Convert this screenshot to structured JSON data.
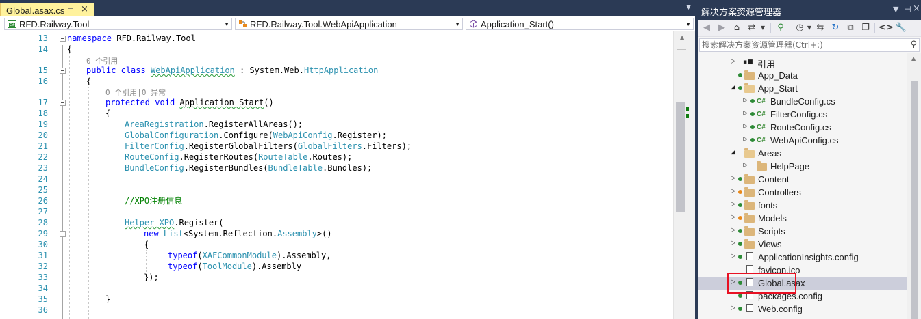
{
  "editor": {
    "tab": {
      "label": "Global.asax.cs"
    },
    "nav": {
      "project": "RFD.Railway.Tool",
      "type": "RFD.Railway.Tool.WebApiApplication",
      "member": "Application_Start()"
    },
    "line_numbers": [
      "13",
      "14",
      "15",
      "16",
      "17",
      "18",
      "19",
      "20",
      "21",
      "22",
      "23",
      "24",
      "25",
      "26",
      "27",
      "28",
      "29",
      "30",
      "31",
      "32",
      "33",
      "34",
      "35",
      "36"
    ],
    "codelens": {
      "class_refs": "0 个引用",
      "method_refs": "0 个引用|0 异常"
    },
    "code": {
      "l13_k": "namespace",
      "l13_t": " RFD.Railway.Tool",
      "l14": "{",
      "l15_k1": "public",
      "l15_k2": "class",
      "l15_name": "WebApiApplication",
      "l15_rest1": " : System.Web.",
      "l15_base": "HttpApplication",
      "l16": "{",
      "l17_k1": "protected",
      "l17_k2": "void",
      "l17_name": "Application_Start",
      "l17_rest": "()",
      "l18": "{",
      "l19_t": "AreaRegistration",
      "l19_r": ".RegisterAllAreas();",
      "l20_t": "GlobalConfiguration",
      "l20_r1": ".Configure(",
      "l20_t2": "WebApiConfig",
      "l20_r2": ".Register);",
      "l21_t": "FilterConfig",
      "l21_r1": ".RegisterGlobalFilters(",
      "l21_t2": "GlobalFilters",
      "l21_r2": ".Filters);",
      "l22_t": "RouteConfig",
      "l22_r1": ".RegisterRoutes(",
      "l22_t2": "RouteTable",
      "l22_r2": ".Routes);",
      "l23_t": "BundleConfig",
      "l23_r1": ".RegisterBundles(",
      "l23_t2": "BundleTable",
      "l23_r2": ".Bundles);",
      "l26_comment": "//XPO注册信息",
      "l28_name": "Helper_XPO",
      "l28_r": ".Register(",
      "l29_k": "new",
      "l29_t": "List",
      "l29_r1": "<System.Reflection.",
      "l29_t2": "Assembly",
      "l29_r2": ">()",
      "l30": "{",
      "l31_k": "typeof",
      "l31_r1": "(",
      "l31_t": "XAFCommonModule",
      "l31_r2": ").Assembly,",
      "l32_k": "typeof",
      "l32_r1": "(",
      "l32_t": "ToolModule",
      "l32_r2": ").Assembly",
      "l33": "});",
      "l35": "}"
    }
  },
  "solution_explorer": {
    "title": "解决方案资源管理器",
    "search_placeholder": "搜索解决方案资源管理器(Ctrl+;)",
    "items": [
      {
        "label": "引用",
        "type": "references",
        "expanded": false
      },
      {
        "label": "App_Data",
        "type": "folder"
      },
      {
        "label": "App_Start",
        "type": "folder",
        "expanded": true
      },
      {
        "label": "BundleConfig.cs",
        "type": "cs"
      },
      {
        "label": "FilterConfig.cs",
        "type": "cs"
      },
      {
        "label": "RouteConfig.cs",
        "type": "cs"
      },
      {
        "label": "WebApiConfig.cs",
        "type": "cs"
      },
      {
        "label": "Areas",
        "type": "folder",
        "expanded": true
      },
      {
        "label": "HelpPage",
        "type": "folder"
      },
      {
        "label": "Content",
        "type": "folder"
      },
      {
        "label": "Controllers",
        "type": "folder"
      },
      {
        "label": "fonts",
        "type": "folder"
      },
      {
        "label": "Models",
        "type": "folder"
      },
      {
        "label": "Scripts",
        "type": "folder"
      },
      {
        "label": "Views",
        "type": "folder"
      },
      {
        "label": "ApplicationInsights.config",
        "type": "config"
      },
      {
        "label": "favicon.ico",
        "type": "file"
      },
      {
        "label": "Global.asax",
        "type": "asax",
        "selected": true
      },
      {
        "label": "packages.config",
        "type": "config"
      },
      {
        "label": "Web.config",
        "type": "config"
      }
    ]
  },
  "colors": {
    "chrome": "#2b3a55",
    "tab_active": "#fff29d",
    "keyword": "#0000ff",
    "type": "#2b91af",
    "comment": "#008000",
    "highlight_box": "#e81123"
  }
}
